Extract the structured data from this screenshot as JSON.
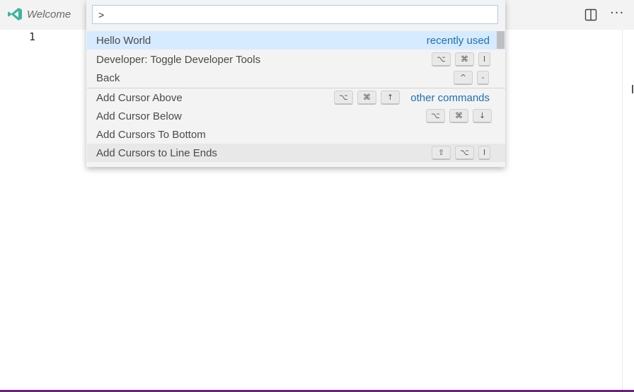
{
  "tab": {
    "label": "Welcome",
    "icon": "vscode-logo-icon"
  },
  "toolbar": {
    "split_icon": "split-editor-icon",
    "more_label": "···"
  },
  "editor": {
    "line_number": "1"
  },
  "palette": {
    "input_value": ">",
    "items": [
      {
        "label": "Hello World",
        "hint": "recently used",
        "keys": []
      },
      {
        "label": "Developer: Toggle Developer Tools",
        "hint": "",
        "keys": [
          "⌥",
          "⌘",
          "I"
        ]
      },
      {
        "label": "Back",
        "hint": "",
        "keys": [
          "^",
          "-"
        ]
      },
      {
        "label": "Add Cursor Above",
        "hint": "other commands",
        "keys": [
          "⌥",
          "⌘",
          "↑"
        ]
      },
      {
        "label": "Add Cursor Below",
        "hint": "",
        "keys": [
          "⌥",
          "⌘",
          "↓"
        ]
      },
      {
        "label": "Add Cursors To Bottom",
        "hint": "",
        "keys": []
      },
      {
        "label": "Add Cursors to Line Ends",
        "hint": "",
        "keys": [
          "⇧",
          "⌥",
          "I"
        ]
      }
    ]
  },
  "colors": {
    "accent": "#1f6fb2",
    "selection": "#d6ebff",
    "status_bar": "#68217a",
    "logo": "#3fb4a0"
  }
}
